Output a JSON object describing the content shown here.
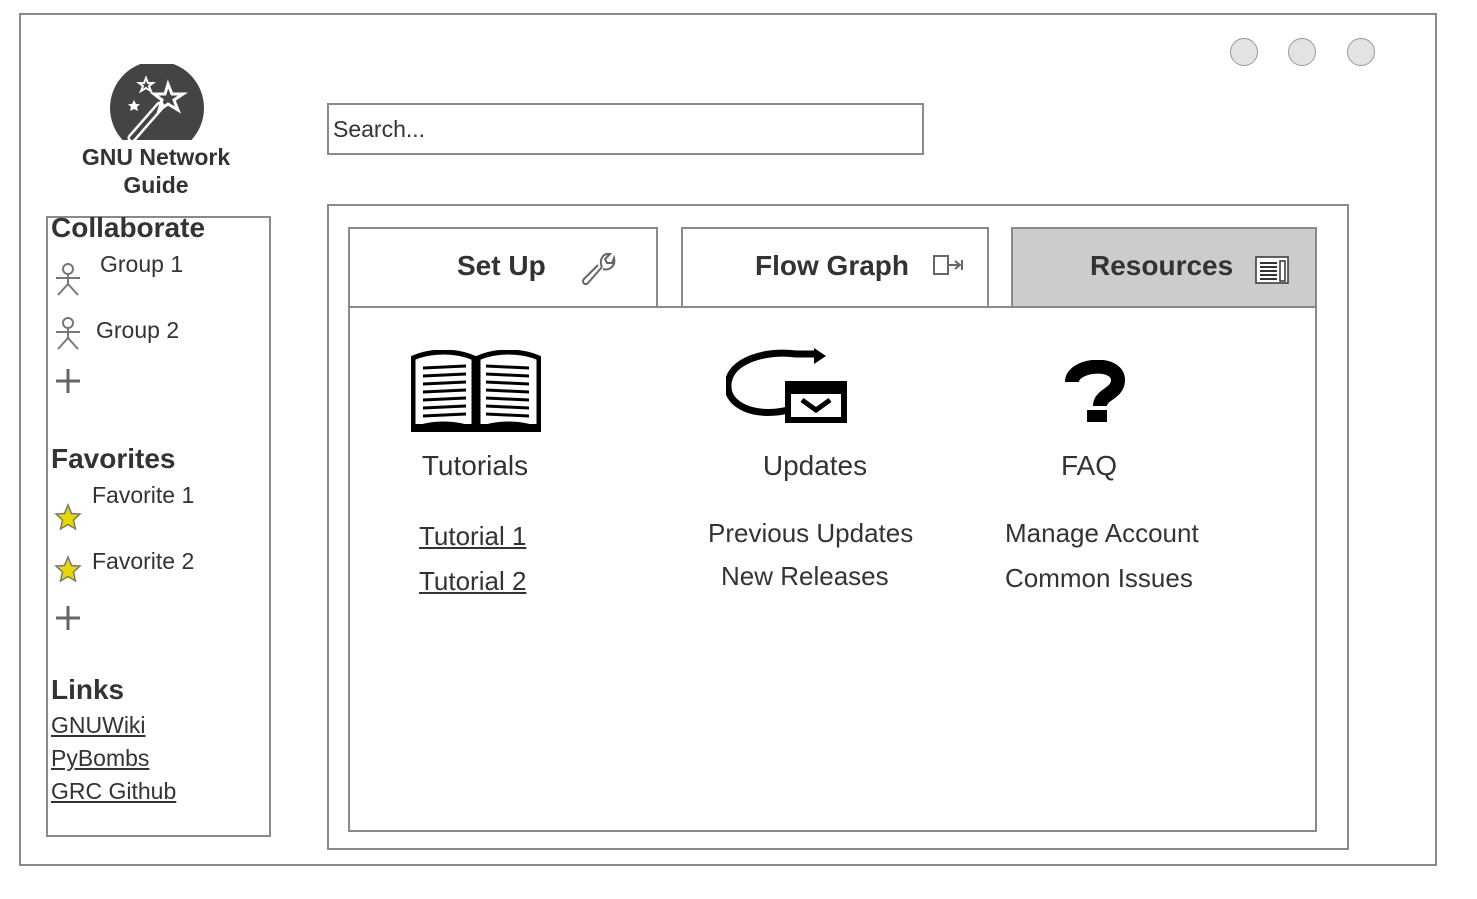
{
  "app": {
    "title_line1": "GNU Network",
    "title_line2": "Guide"
  },
  "search": {
    "placeholder": "Search..."
  },
  "sidebar": {
    "collaborate": {
      "title": "Collaborate",
      "items": [
        {
          "label": "Group 1",
          "icon": "person-icon"
        },
        {
          "label": "Group 2",
          "icon": "person-icon"
        }
      ]
    },
    "favorites": {
      "title": "Favorites",
      "items": [
        {
          "label": "Favorite 1",
          "icon": "star-icon"
        },
        {
          "label": "Favorite 2",
          "icon": "star-icon"
        }
      ]
    },
    "links": {
      "title": "Links",
      "items": [
        "GNUWiki",
        "PyBombs",
        "GRC Github"
      ]
    }
  },
  "tabs": [
    {
      "label": "Set Up",
      "icon": "wrench-icon",
      "active": false
    },
    {
      "label": "Flow Graph",
      "icon": "flow-graph-icon",
      "active": false
    },
    {
      "label": "Resources",
      "icon": "document-icon",
      "active": true
    }
  ],
  "resources": {
    "tutorials": {
      "title": "Tutorials",
      "icon": "book-icon",
      "links": [
        "Tutorial 1",
        "Tutorial 2"
      ]
    },
    "updates": {
      "title": "Updates",
      "icon": "refresh-mail-icon",
      "links": [
        "Previous Updates",
        "New Releases"
      ]
    },
    "faq": {
      "title": "FAQ",
      "icon": "question-icon",
      "links": [
        "Manage Account",
        "Common Issues"
      ]
    }
  },
  "colors": {
    "border": "#8a8a8a",
    "active_tab": "#cccccc",
    "star": "#e6d800",
    "text": "#333333"
  }
}
